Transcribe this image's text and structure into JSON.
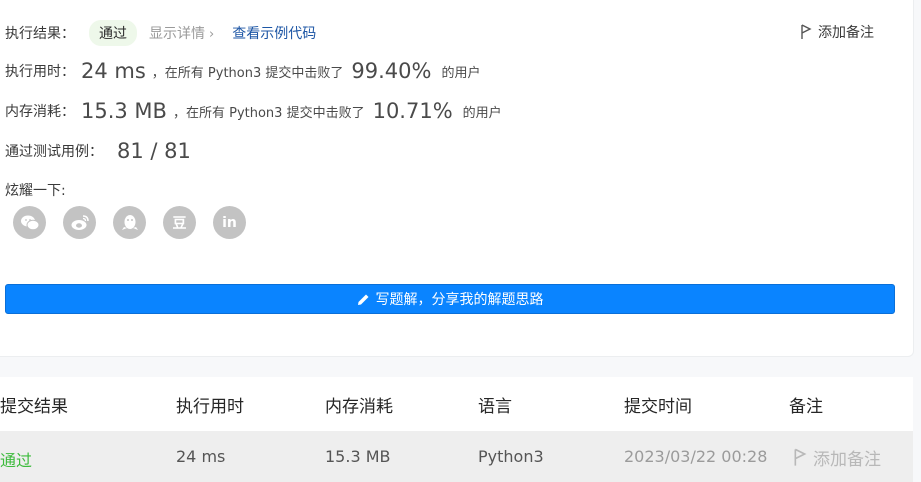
{
  "result": {
    "label": "执行结果：",
    "status": "通过",
    "details": "显示详情",
    "details_chevron": "›",
    "example_code": "查看示例代码",
    "add_note": "添加备注"
  },
  "runtime": {
    "label": "执行用时：",
    "value": "24 ms",
    "text_before": "，在所有 Python3 提交中击败了",
    "percent": "99.40%",
    "text_after": "的用户"
  },
  "memory": {
    "label": "内存消耗：",
    "value": "15.3 MB",
    "text_before": "，在所有 Python3 提交中击败了",
    "percent": "10.71%",
    "text_after": "的用户"
  },
  "tests": {
    "label": "通过测试用例：",
    "value": "81 / 81"
  },
  "share": {
    "label": "炫耀一下:",
    "icons": [
      "wechat-icon",
      "weibo-icon",
      "qq-icon",
      "douban-icon",
      "linkedin-icon"
    ],
    "douban_glyph": "豆",
    "linkedin_glyph": "in"
  },
  "solution_button": "写题解，分享我的解题思路",
  "submissions": {
    "headers": [
      "提交结果",
      "执行用时",
      "内存消耗",
      "语言",
      "提交时间",
      "备注"
    ],
    "rows": [
      {
        "result": "通过",
        "runtime": "24 ms",
        "memory": "15.3 MB",
        "language": "Python3",
        "time": "2023/03/22 00:28",
        "note": "添加备注"
      }
    ]
  },
  "colors": {
    "accent": "#0a84ff",
    "pass": "#3dbb3d",
    "link": "#1d56a5"
  }
}
